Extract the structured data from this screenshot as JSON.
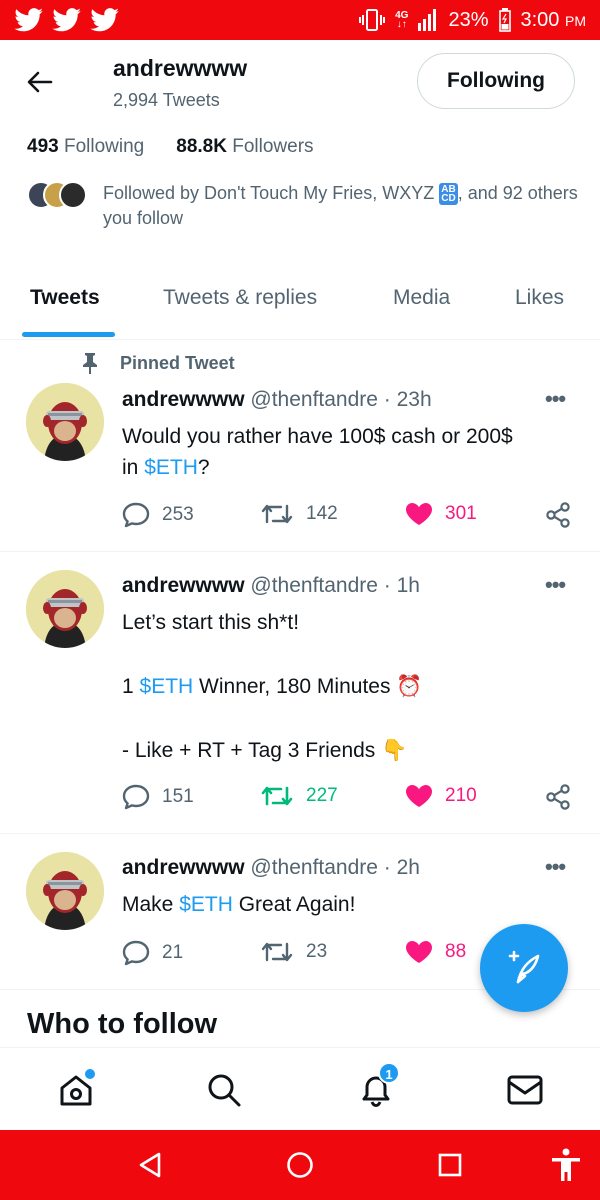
{
  "status_bar": {
    "network": "4G",
    "battery": "23%",
    "time": "3:00",
    "ampm": "PM"
  },
  "header": {
    "display_name": "andrewwww",
    "tweet_count": "2,994 Tweets",
    "follow_button": "Following"
  },
  "counts": {
    "following_value": "493",
    "following_label": "Following",
    "followers_value": "88.8K",
    "followers_label": "Followers"
  },
  "followed_by": {
    "text_start": "Followed by Don't Touch My Fries, WXYZ",
    "emoji_text": "AB CD",
    "text_end": ", and 92 others you follow"
  },
  "tabs": [
    {
      "label": "Tweets",
      "active": true
    },
    {
      "label": "Tweets & replies",
      "active": false
    },
    {
      "label": "Media",
      "active": false
    },
    {
      "label": "Likes",
      "active": false
    }
  ],
  "pinned_label": "Pinned Tweet",
  "tweets": [
    {
      "name": "andrewwww",
      "meta": "@thenftandre · 23h",
      "body": {
        "line1": "Would you rather have 100$ cash or 200$",
        "line2_pre": "in ",
        "line2_link": "$ETH",
        "line2_post": "?"
      },
      "replies": "253",
      "retweets": "142",
      "likes": "301"
    },
    {
      "name": "andrewwww",
      "meta": "@thenftandre · 1h",
      "body": {
        "line1": "Let’s start this sh*t!",
        "line2_pre": "1 ",
        "line2_link": "$ETH",
        "line2_post": " Winner, 180 Minutes ⏰",
        "line3": "- Like + RT + Tag 3 Friends 👇"
      },
      "replies": "151",
      "retweets": "227",
      "likes": "210"
    },
    {
      "name": "andrewwww",
      "meta": "@thenftandre · 2h",
      "body": {
        "line1_pre": "Make ",
        "line1_link": "$ETH",
        "line1_post": " Great Again!"
      },
      "replies": "21",
      "retweets": "23",
      "likes": "88"
    }
  ],
  "who_to_follow": "Who to follow",
  "notifications_badge": "1",
  "colors": {
    "status_bar": "#f0080f",
    "accent": "#1d9bf0",
    "like": "#f91880",
    "retweet_active": "#00ba7c",
    "muted": "#536471"
  },
  "icons": [
    "twitter-bird-icon",
    "vibrate-icon",
    "signal-icon",
    "battery-icon",
    "back-arrow-icon",
    "pin-icon",
    "more-icon",
    "reply-icon",
    "retweet-icon",
    "heart-icon",
    "share-icon",
    "compose-icon",
    "home-icon",
    "search-icon",
    "bell-icon",
    "mail-icon",
    "android-back-icon",
    "android-home-icon",
    "android-recents-icon",
    "accessibility-icon"
  ]
}
